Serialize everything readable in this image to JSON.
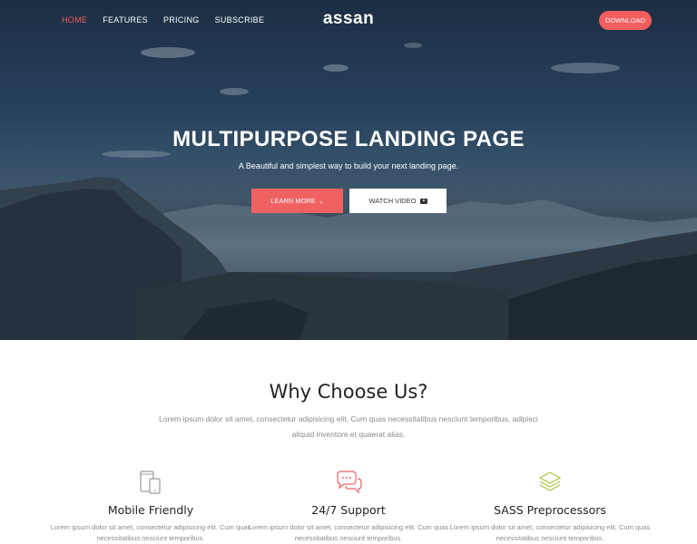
{
  "nav": {
    "brand": "assan",
    "links": [
      "HOME",
      "FEATURES",
      "PRICING",
      "SUBSCRIBE"
    ],
    "active_index": 0,
    "download_label": "DOWNLOAD"
  },
  "hero": {
    "title": "MULTIPURPOSE LANDING PAGE",
    "subtitle": "A Beautiful and simplest way to build your next landing page.",
    "learn_more_label": "LEARN MORE",
    "watch_video_label": "WATCH VIDEO"
  },
  "why": {
    "title": "Why Choose Us?",
    "description": "Lorem ipsum dolor sit amet, consectetur adipisicing elit. Cum quas necessitatibus nesciunt temporibus, adipisci aliquid inventore et quaerat alias."
  },
  "features": [
    {
      "title": "Mobile Friendly",
      "icon": "mobile-devices-icon",
      "description": "Lorem ipsum dolor sit amet, consectetur adipisicing elit. Cum quas necessitatibus nesciunt temporibus."
    },
    {
      "title": "24/7 Support",
      "icon": "chat-bubbles-icon",
      "description": "Lorem ipsum dolor sit amet, consectetur adipisicing elit. Cum quas necessitatibus nesciunt temporibus."
    },
    {
      "title": "SASS Preprocessors",
      "icon": "layers-icon",
      "description": "Lorem ipsum dolor sit amet, consectetur adipisicing elit. Cum quas necessitatibus nesciunt temporibus."
    }
  ],
  "colors": {
    "accent": "#f35d5d",
    "mobile_icon": "#9a9a9a",
    "support_icon": "#f06262",
    "layers_icon": "#a9c23f"
  }
}
